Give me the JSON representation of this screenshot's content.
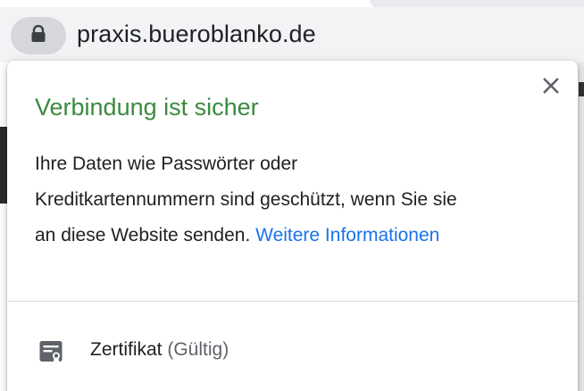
{
  "address_bar": {
    "url": "praxis.bueroblanko.de",
    "lock_icon": "lock-icon"
  },
  "popup": {
    "title": "Verbindung ist sicher",
    "body_line_1": "Ihre Daten wie Passwörter oder",
    "body_line_2": "Kreditkartennummern sind geschützt, wenn Sie sie",
    "body_line_3": "an diese Website senden.",
    "more_info_link": "Weitere Informationen",
    "close_icon": "close-icon",
    "certificate": {
      "label": "Zertifikat",
      "status": "(Gültig)",
      "icon": "certificate-icon"
    }
  },
  "colors": {
    "title_green": "#3a8a3f",
    "link_blue": "#1a73e8",
    "text": "#202124",
    "muted": "#5f6368"
  }
}
